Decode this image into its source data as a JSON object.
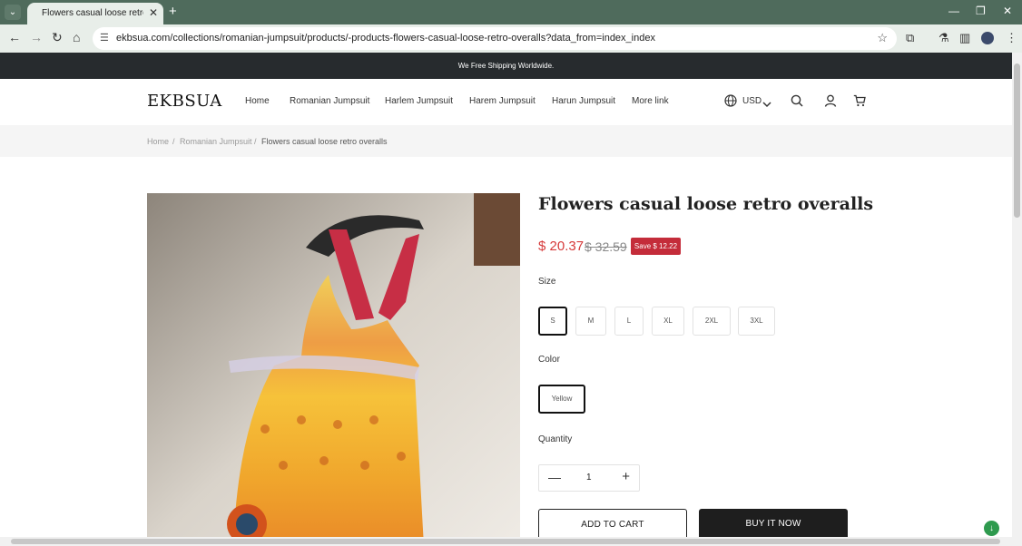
{
  "browser": {
    "tab_title": "Flowers casual loose retro overa",
    "url": "ekbsua.com/collections/romanian-jumpsuit/products/-products-flowers-casual-loose-retro-overalls?data_from=index_index"
  },
  "announcement": "We Free Shipping Worldwide.",
  "header": {
    "logo": "EKBSUA",
    "nav": [
      "Home",
      "Romanian Jumpsuit",
      "Harlem Jumpsuit",
      "Harem Jumpsuit",
      "Harun Jumpsuit",
      "More link"
    ],
    "currency": "USD"
  },
  "breadcrumb": {
    "items": [
      "Home",
      "Romanian Jumpsuit",
      "Flowers casual loose retro overalls"
    ],
    "separator": "/"
  },
  "product": {
    "title": "Flowers casual loose retro overalls",
    "price": "$ 20.37",
    "original_price": "$ 32.59",
    "save_badge": "Save $ 12.22",
    "size_label": "Size",
    "sizes": [
      "S",
      "M",
      "L",
      "XL",
      "2XL",
      "3XL"
    ],
    "selected_size": "S",
    "color_label": "Color",
    "colors": [
      "Yellow"
    ],
    "selected_color": "Yellow",
    "quantity_label": "Quantity",
    "quantity": "1",
    "add_to_cart": "ADD TO CART",
    "buy_now": "BUY IT NOW"
  },
  "colors": {
    "browser_frame": "#4f6b5c",
    "announcement_bg": "#272b2e",
    "price": "#d63a3a",
    "save_badge": "#c42c3a",
    "buy_button": "#1e1e1e"
  }
}
